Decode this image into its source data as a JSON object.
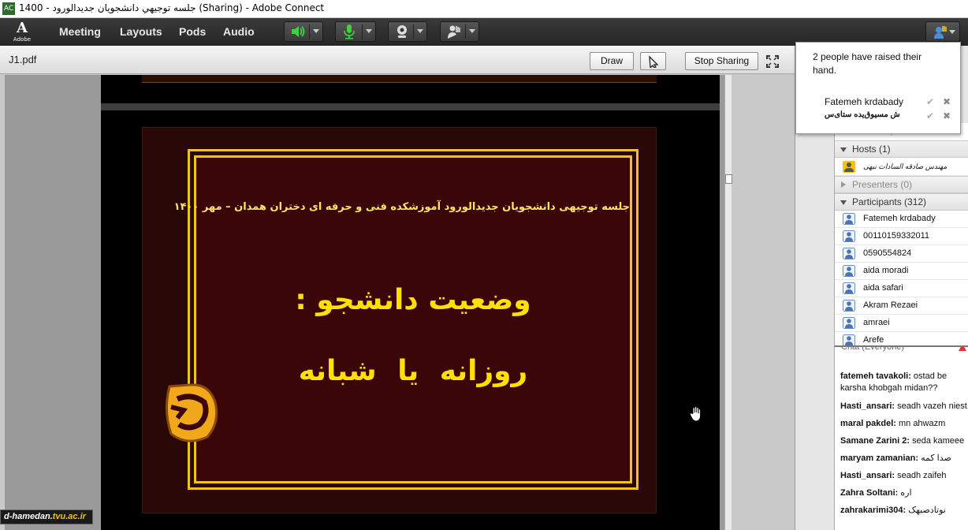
{
  "window": {
    "title": "جلسه توجيهي دانشجويان جديدالورود - 1400 (Sharing) - Adobe Connect"
  },
  "adobe_logo": {
    "mark": "A",
    "text": "Adobe"
  },
  "menubar": {
    "items": [
      "Meeting",
      "Layouts",
      "Pods",
      "Audio"
    ]
  },
  "toolbar": {
    "speaker": {
      "icon": "speaker-icon",
      "color": "#3fcf3f"
    },
    "microphone": {
      "icon": "microphone-icon",
      "color": "#3fcf3f"
    },
    "camera": {
      "icon": "webcam-icon"
    },
    "status": {
      "icon": "raise-hand-status-icon"
    },
    "attendee_menu": {
      "icon": "raised-hand-notification-icon"
    }
  },
  "share_pod": {
    "document_title": "J1.pdf",
    "draw_label": "Draw",
    "stop_sharing_label": "Stop Sharing"
  },
  "slide": {
    "subtitle": "جلسه توجیهی دانشجویان جدیدالورود آموزشکده فنی و حرفه ای دختران همدان – مهر ۱۴۰۰",
    "heading": "وضعیت دانشجو :",
    "subheading": "روزانه  یا  شبانه",
    "colors": {
      "frame": "#f2c21b",
      "background": "#3b0608",
      "text": "#ffe000"
    }
  },
  "watermark": {
    "part1": "d-hamedan.",
    "part2": "tvu.ac.ir"
  },
  "raised_hand_popup": {
    "message": "2 people have raised their hand.",
    "people": [
      "Fatemeh krdabady",
      "ش مسیوق‌یده ستای‌س"
    ]
  },
  "attendees": {
    "ghost_label": "Active Speakers",
    "hosts": {
      "label": "Hosts (1)",
      "members": [
        "مهندس صادقه السادات نبهی"
      ]
    },
    "presenters": {
      "label": "Presenters (0)"
    },
    "participants": {
      "label": "Participants (312)",
      "members": [
        "Fatemeh krdabady",
        "00110159332011",
        "0590554824",
        "aida moradi",
        "aida safari",
        "Akram Rezaei",
        "amraei",
        "Arefe"
      ]
    }
  },
  "chat": {
    "title": "Chat  (Everyone)",
    "messages": [
      {
        "user": "fatemeh tavakoli:",
        "text": " ostad be karsha khobgah midan??"
      },
      {
        "user": "Hasti_ansari:",
        "text": " seadh vazeh niest"
      },
      {
        "user": "maral pakdel:",
        "text": " mn ahwazm"
      },
      {
        "user": "Samane Zarini 2:",
        "text": " seda kameee"
      },
      {
        "user": "maryam zamanian:",
        "text": " صدا کمه"
      },
      {
        "user": "Hasti_ansari:",
        "text": " seadh zaifeh"
      },
      {
        "user": "Zahra Soltani:",
        "text": " اره"
      },
      {
        "user": "zahrakarimi304:",
        "text": " نوتادصبهک"
      }
    ]
  }
}
